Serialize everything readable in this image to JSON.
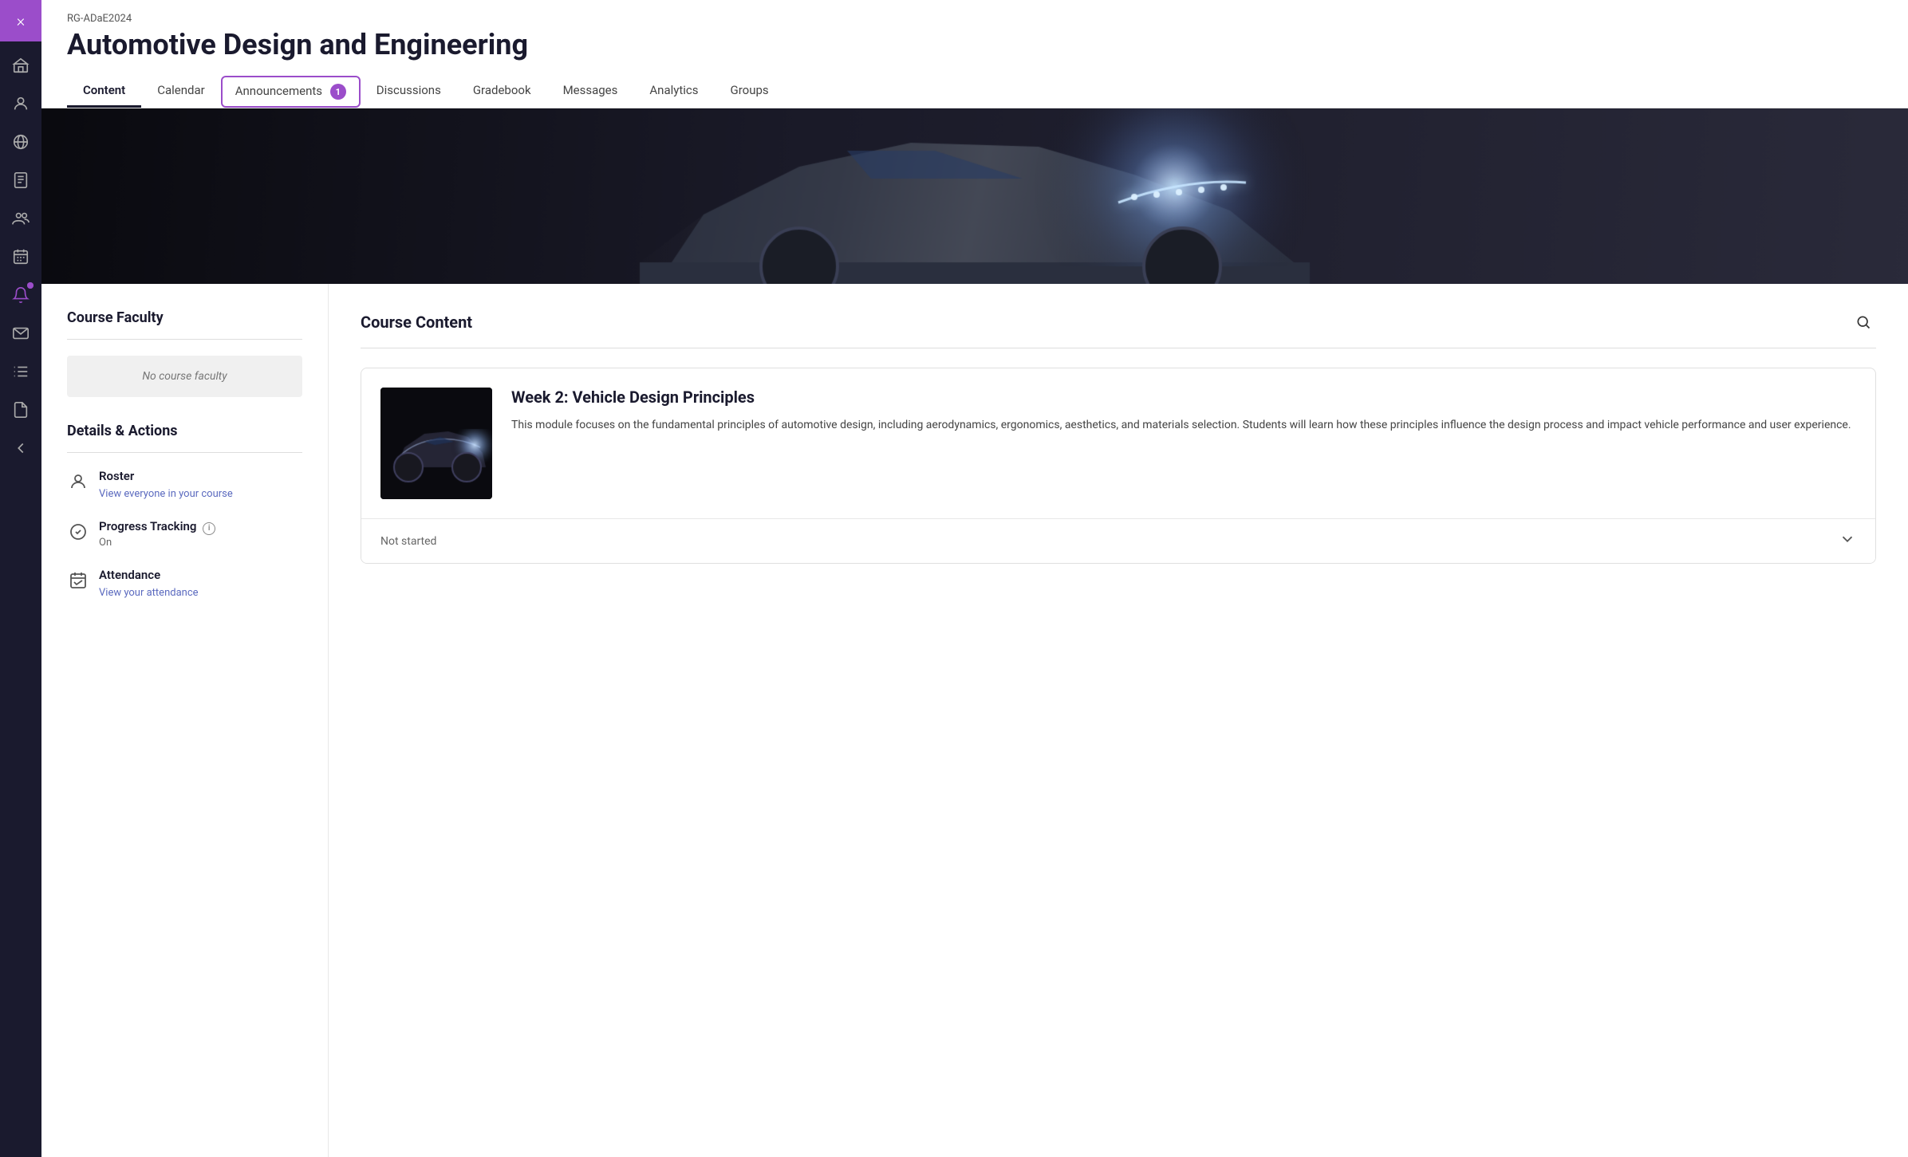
{
  "sidebar": {
    "close_label": "×",
    "items": [
      {
        "name": "institution-icon",
        "icon": "🏛",
        "active": false
      },
      {
        "name": "user-icon",
        "icon": "👤",
        "active": false
      },
      {
        "name": "globe-icon",
        "icon": "🌐",
        "active": false
      },
      {
        "name": "gradebook-icon",
        "icon": "📋",
        "active": false
      },
      {
        "name": "groups-icon",
        "icon": "👥",
        "active": false
      },
      {
        "name": "calendar-grid-icon",
        "icon": "📅",
        "active": false
      },
      {
        "name": "notification-icon",
        "icon": "🔔",
        "active": true,
        "has_dot": true
      },
      {
        "name": "messages-icon",
        "icon": "✉",
        "active": false
      },
      {
        "name": "list-icon",
        "icon": "📝",
        "active": false
      },
      {
        "name": "document-icon",
        "icon": "📄",
        "active": false
      },
      {
        "name": "back-icon",
        "icon": "↩",
        "active": false
      }
    ]
  },
  "header": {
    "course_code": "RG-ADaE2024",
    "course_title": "Automotive Design and Engineering",
    "tabs": [
      {
        "id": "content",
        "label": "Content",
        "active": true,
        "highlighted": false
      },
      {
        "id": "calendar",
        "label": "Calendar",
        "active": false,
        "highlighted": false
      },
      {
        "id": "announcements",
        "label": "Announcements",
        "active": false,
        "highlighted": true,
        "badge": 1
      },
      {
        "id": "discussions",
        "label": "Discussions",
        "active": false,
        "highlighted": false
      },
      {
        "id": "gradebook",
        "label": "Gradebook",
        "active": false,
        "highlighted": false
      },
      {
        "id": "messages",
        "label": "Messages",
        "active": false,
        "highlighted": false
      },
      {
        "id": "analytics",
        "label": "Analytics",
        "active": false,
        "highlighted": false
      },
      {
        "id": "groups",
        "label": "Groups",
        "active": false,
        "highlighted": false
      }
    ]
  },
  "left_panel": {
    "faculty_section_title": "Course Faculty",
    "no_faculty_text": "No course faculty",
    "details_section_title": "Details & Actions",
    "details": [
      {
        "name": "roster",
        "icon": "person",
        "label": "Roster",
        "link_text": "View everyone in your course",
        "link_href": "#"
      },
      {
        "name": "progress-tracking",
        "icon": "check-circle",
        "label": "Progress Tracking",
        "has_info": true,
        "value": "On"
      },
      {
        "name": "attendance",
        "icon": "calendar-check",
        "label": "Attendance",
        "link_text": "View your attendance",
        "link_href": "#"
      }
    ]
  },
  "right_panel": {
    "section_title": "Course Content",
    "modules": [
      {
        "id": "week2",
        "title": "Week 2: Vehicle Design Principles",
        "description": "This module focuses on the fundamental principles of automotive design, including aerodynamics, ergonomics, aesthetics, and materials selection. Students will learn how these principles influence the design process and impact vehicle performance and user experience.",
        "status": "Not started"
      }
    ]
  },
  "colors": {
    "purple_accent": "#9b4dca",
    "dark_navy": "#1a1a2e",
    "link_blue": "#5b6abf"
  }
}
